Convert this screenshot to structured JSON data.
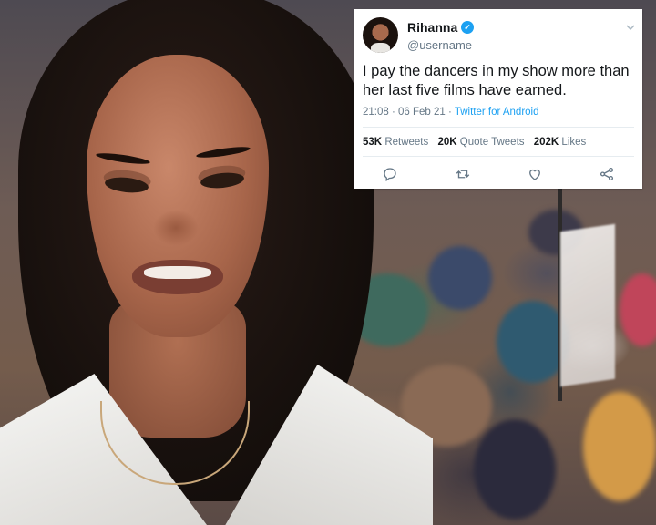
{
  "tweet": {
    "display_name": "Rihanna",
    "handle": "@username",
    "text": "I pay the dancers in my show more than her last five films have earned.",
    "time": "21:08 · 06 Feb 21 · ",
    "source": "Twitter for Android",
    "stats": {
      "retweets_count": "53K",
      "retweets_label": "Retweets",
      "quote_count": "20K",
      "quote_label": "Quote Tweets",
      "likes_count": "202K",
      "likes_label": "Likes"
    },
    "icons": [
      "verified-icon",
      "chevron-down-icon",
      "reply-icon",
      "retweet-icon",
      "like-icon",
      "share-icon"
    ]
  },
  "colors": {
    "accent": "#1da1f2",
    "secondary_text": "#657786",
    "primary_text": "#14171a"
  }
}
